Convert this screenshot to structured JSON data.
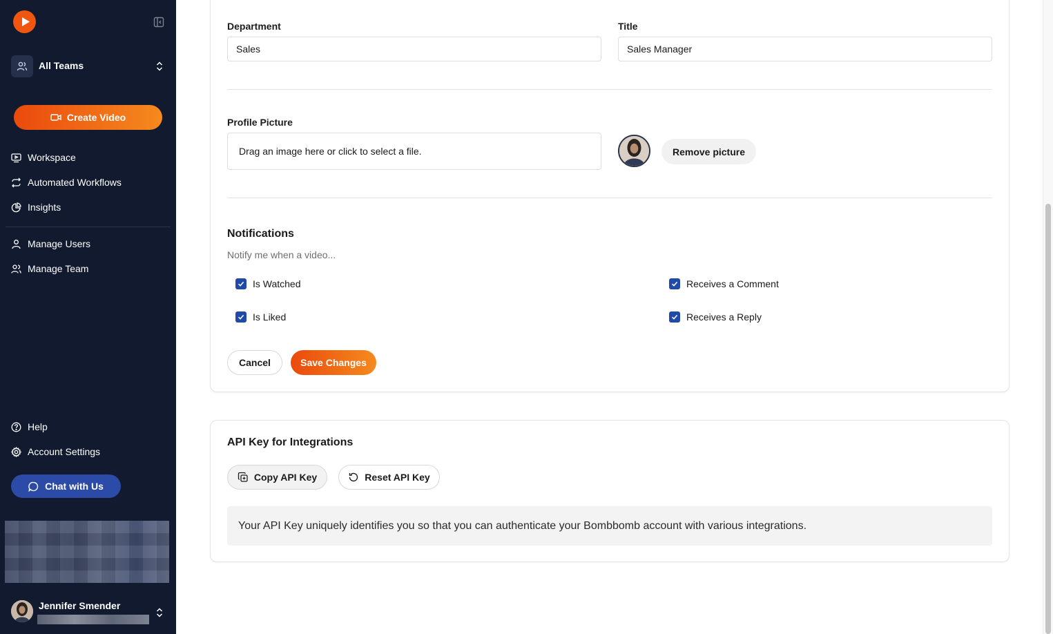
{
  "sidebar": {
    "team_label": "All Teams",
    "create_label": "Create Video",
    "nav_primary": [
      {
        "label": "Workspace",
        "icon": "monitor-play-icon"
      },
      {
        "label": "Automated Workflows",
        "icon": "repeat-arrows-icon"
      },
      {
        "label": "Insights",
        "icon": "pie-chart-icon"
      }
    ],
    "nav_admin": [
      {
        "label": "Manage Users",
        "icon": "user-icon"
      },
      {
        "label": "Manage Team",
        "icon": "users-icon"
      }
    ],
    "nav_bottom": [
      {
        "label": "Help",
        "icon": "help-circle-icon"
      },
      {
        "label": "Account Settings",
        "icon": "gear-icon"
      }
    ],
    "chat_label": "Chat with Us",
    "user_name": "Jennifer Smender"
  },
  "profile_form": {
    "department_label": "Department",
    "department_value": "Sales",
    "title_label": "Title",
    "title_value": "Sales Manager",
    "picture_label": "Profile Picture",
    "dropzone_text": "Drag an image here or click to select a file.",
    "remove_picture_label": "Remove picture"
  },
  "notifications": {
    "heading": "Notifications",
    "subtext": "Notify me when a video...",
    "options": [
      {
        "label": "Is Watched",
        "checked": true
      },
      {
        "label": "Receives a Comment",
        "checked": true
      },
      {
        "label": "Is Liked",
        "checked": true
      },
      {
        "label": "Receives a Reply",
        "checked": true
      }
    ],
    "cancel_label": "Cancel",
    "save_label": "Save Changes"
  },
  "api_key": {
    "heading": "API Key for Integrations",
    "copy_label": "Copy API Key",
    "reset_label": "Reset API Key",
    "info_text": "Your API Key uniquely identifies you so that you can authenticate your Bombbomb account with various integrations."
  },
  "colors": {
    "sidebar_bg": "#111a2e",
    "accent_orange": "#ea4a0c",
    "accent_blue": "#2c4aa8",
    "checkbox_blue": "#1f4aa8"
  }
}
